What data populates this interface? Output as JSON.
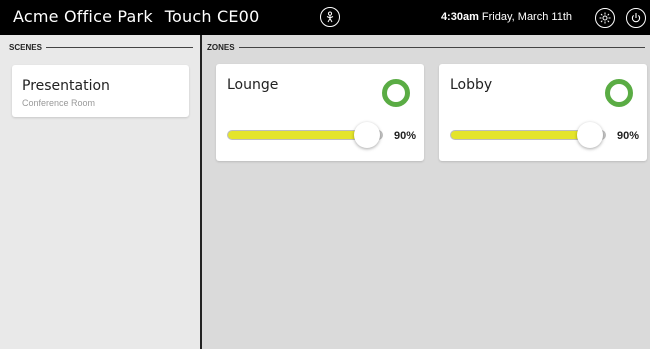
{
  "header": {
    "site_name": "Acme Office Park",
    "device_name": "Touch CE00",
    "time": "4:30am",
    "date": "Friday, March 11th"
  },
  "icons": {
    "center": "person-icon",
    "brightness": "sun-icon",
    "power": "power-icon"
  },
  "scenes": {
    "heading": "SCENES",
    "items": [
      {
        "title": "Presentation",
        "subtitle": "Conference Room"
      }
    ]
  },
  "zones": {
    "heading": "ZONES",
    "items": [
      {
        "name": "Lounge",
        "level_label": "90%",
        "level_percent": 90,
        "status_color": "#5aac44"
      },
      {
        "name": "Lobby",
        "level_label": "90%",
        "level_percent": 90,
        "status_color": "#5aac44"
      }
    ]
  },
  "colors": {
    "topbar": "#000000",
    "slider_fill": "#e4e42b",
    "status_ring": "#5aac44"
  }
}
